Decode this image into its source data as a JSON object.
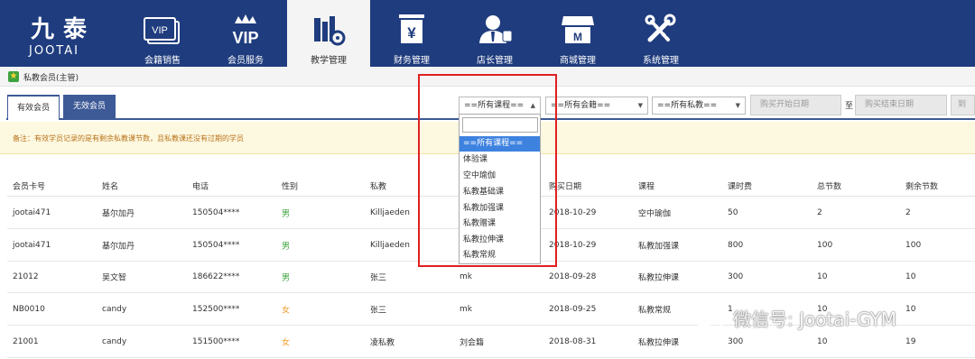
{
  "logo": {
    "cn": "九泰",
    "en": "JOOTAI"
  },
  "nav": [
    {
      "label": "会籍销售",
      "icon": "vip-card-icon"
    },
    {
      "label": "会员服务",
      "icon": "vip-crown-icon"
    },
    {
      "label": "教学管理",
      "icon": "books-gear-icon",
      "active": true
    },
    {
      "label": "财务管理",
      "icon": "yuan-box-icon"
    },
    {
      "label": "店长管理",
      "icon": "manager-icon"
    },
    {
      "label": "商城管理",
      "icon": "store-icon"
    },
    {
      "label": "系统管理",
      "icon": "tools-icon"
    }
  ],
  "nav_logo_text": {
    "vip_card": "VIP",
    "vip_crown": "VIP",
    "yuan": "¥",
    "store": "M"
  },
  "breadcrumb": "私教会员(主管)",
  "tabs": {
    "active": "有效会员",
    "inactive": "无效会员"
  },
  "filters": {
    "course": "==所有课程==",
    "membership": "==所有会籍==",
    "coach": "==所有私教==",
    "start_date_placeholder": "购买开始日期",
    "to": "至",
    "end_date_placeholder": "购买结束日期",
    "cut_button": "到"
  },
  "course_dropdown": {
    "options": [
      "==所有课程==",
      "体验课",
      "空中瑜伽",
      "私教基础课",
      "私教加强课",
      "私教赠课",
      "私教拉伸课",
      "私教常规"
    ],
    "selected_index": 0
  },
  "note": "备注：有效学员记录的是有剩余私教课节数，且私教课还没有过期的学员",
  "table": {
    "headers": [
      "会员卡号",
      "姓名",
      "电话",
      "性别",
      "私教",
      "",
      "购买日期",
      "课程",
      "课时费",
      "总节数",
      "剩余节数"
    ],
    "rows": [
      [
        "jootai471",
        "基尔加丹",
        "150504****",
        "男",
        "Killjaeden",
        "",
        "2018-10-29",
        "空中瑜伽",
        "50",
        "2",
        "2"
      ],
      [
        "jootai471",
        "基尔加丹",
        "150504****",
        "男",
        "Killjaeden",
        "",
        "2018-10-29",
        "私教加强课",
        "800",
        "100",
        "100"
      ],
      [
        "21012",
        "吴文智",
        "186622****",
        "男",
        "张三",
        "mk",
        "2018-09-28",
        "私教拉伸课",
        "300",
        "10",
        "10"
      ],
      [
        "NB0010",
        "candy",
        "152500****",
        "女",
        "张三",
        "mk",
        "2018-09-25",
        "私教常规",
        "1",
        "10",
        "10"
      ],
      [
        "21001",
        "candy",
        "151500****",
        "女",
        "凌私教",
        "刘会籍",
        "2018-08-31",
        "私教拉伸课",
        "300",
        "10",
        "19"
      ]
    ]
  },
  "watermark": "微信号: Jootai-GYM",
  "colors": {
    "nav_bg": "#1f3c7e",
    "accent": "#3d5a96",
    "highlight_border": "#e02020",
    "male": "#3ca33c",
    "female": "#f0a030"
  }
}
